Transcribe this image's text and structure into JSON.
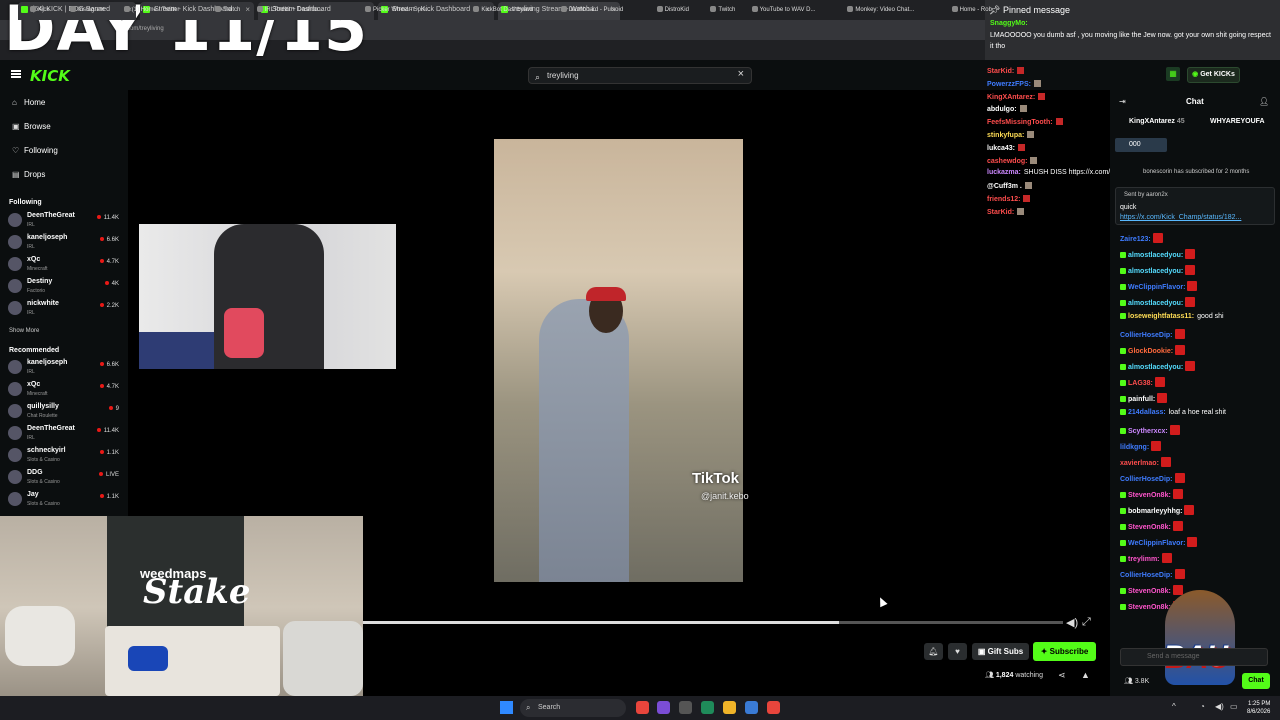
{
  "overlay": {
    "day_title": "DAY 11/15"
  },
  "browser": {
    "tabs": [
      {
        "label": "(64) KICK | DDG Banned"
      },
      {
        "label": "Stream - Kick Dashboard"
      },
      {
        "label": "Stream Dashboard"
      },
      {
        "label": "Stream - Kick Dashboard"
      },
      {
        "label": "treyliving Stream - Watch L"
      }
    ],
    "address": "kick.com/treyliving",
    "bookmarks": [
      "Kick",
      "Instagram",
      "(1) Home / Twitter",
      "Twitch",
      "IRLToolkit + Dashbo...",
      "Picker Wheel - Spin...",
      "KickBot Dashboard",
      "Dashboard - Pulsoid",
      "DistroKid",
      "Twitch",
      "YouTube to WAV D...",
      "Monkey: Video Chat...",
      "Home - Rob"
    ]
  },
  "kick": {
    "logo": "KICK",
    "search": {
      "value": "treyliving"
    },
    "nav": [
      {
        "label": "Home",
        "icon": "home-icon",
        "glyph": "⌂"
      },
      {
        "label": "Browse",
        "icon": "browse-icon",
        "glyph": "▣"
      },
      {
        "label": "Following",
        "icon": "heart-icon",
        "glyph": "♡"
      },
      {
        "label": "Drops",
        "icon": "drops-icon",
        "glyph": "▤"
      }
    ],
    "following_header": "Following",
    "following": [
      {
        "name": "DeenTheGreat",
        "category": "IRL",
        "viewers": "11.4K"
      },
      {
        "name": "kaneljoseph",
        "category": "IRL",
        "viewers": "6.6K"
      },
      {
        "name": "xQc",
        "category": "Minecraft",
        "viewers": "4.7K"
      },
      {
        "name": "Destiny",
        "category": "Factorio",
        "viewers": "4K"
      },
      {
        "name": "nickwhite",
        "category": "IRL",
        "viewers": "2.2K"
      }
    ],
    "show_more": "Show More",
    "recommended_header": "Recommended",
    "recommended": [
      {
        "name": "kaneljoseph",
        "category": "IRL",
        "viewers": "6.6K"
      },
      {
        "name": "xQc",
        "category": "Minecraft",
        "viewers": "4.7K"
      },
      {
        "name": "quillysilly",
        "category": "Chat Roulette",
        "viewers": "9"
      },
      {
        "name": "DeenTheGreat",
        "category": "IRL",
        "viewers": "11.4K"
      },
      {
        "name": "schneckyirl",
        "category": "Slots & Casino",
        "viewers": "1.1K"
      },
      {
        "name": "DDG",
        "category": "Slots & Casino",
        "viewers": "LIVE"
      },
      {
        "name": "Jay",
        "category": "Slots & Casino",
        "viewers": "1.1K"
      }
    ]
  },
  "player": {
    "tiktok_label": "TikTok",
    "tiktok_handle": "@janit.kebo",
    "webcam_sponsor1": "weedmaps",
    "webcam_sponsor2": "Stake",
    "progress": 0.68,
    "gift_subs": "Gift Subs",
    "subscribe": "Subscribe",
    "watching_count": "1,824",
    "watching_label": "watching"
  },
  "pinned": {
    "header": "Pinned message",
    "user": "SnaggyMo:",
    "message": "LMAOOOOO you dumb asf , you moving like the Jew now. got your own shit going respect it tho"
  },
  "overlay_chat": [
    {
      "user": "StarKid:",
      "color": "#ff4d4d",
      "text": ""
    },
    {
      "user": "PowerzzFPS:",
      "color": "#3f7cff",
      "text": ""
    },
    {
      "user": "KingXAntarez:",
      "color": "#ff4d4d",
      "text": ""
    },
    {
      "user": "abdulgo:",
      "color": "#ffffff",
      "text": ""
    },
    {
      "user": "FeefsMissingTooth:",
      "color": "#ff4d4d",
      "text": ""
    },
    {
      "user": "stinkyfupa:",
      "color": "#ffdd55",
      "text": ""
    },
    {
      "user": "lukca43:",
      "color": "#ffffff",
      "text": ""
    },
    {
      "user": "cashewdog:",
      "color": "#ff4d4d",
      "text": ""
    },
    {
      "user": "luckazma:",
      "color": "#cc88ff",
      "text": "SHUSH DISS https://x.com/lucka177/status/2085470509090308301"
    },
    {
      "user": "@Cuff3m .",
      "color": "#ffffff",
      "text": ""
    },
    {
      "user": "friends12:",
      "color": "#ff4d4d",
      "text": ""
    },
    {
      "user": "StarKid:",
      "color": "#ff4d4d",
      "text": ""
    }
  ],
  "chat": {
    "title": "Chat",
    "get_kicks": "Get KICKs",
    "top_pins": [
      "KingXAntarez",
      "WHYAREYOUFA"
    ],
    "top_pin_count": "45",
    "goal": "000",
    "sub_note": "bonescorin has subscribed for 2 months",
    "sent_by": "Sent by aaron2x",
    "sent_text": "quick",
    "sent_link": "https://x.com/Kick_Champ/status/182...",
    "messages": [
      {
        "user": "Zaire123:",
        "color": "#3f7cff",
        "text": "",
        "badge": false
      },
      {
        "user": "almostlacedyou:",
        "color": "#55ddff",
        "text": "",
        "badge": true
      },
      {
        "user": "almostlacedyou:",
        "color": "#55ddff",
        "text": "",
        "badge": true
      },
      {
        "user": "WeClippinFlavor:",
        "color": "#3f7cff",
        "text": "",
        "badge": true
      },
      {
        "user": "almostlacedyou:",
        "color": "#55ddff",
        "text": "",
        "badge": true
      },
      {
        "user": "loseweightfatass11:",
        "color": "#ffdd55",
        "text": "good shi",
        "badge": true
      },
      {
        "user": "CollierHoseDip:",
        "color": "#3f7cff",
        "text": "",
        "badge": false
      },
      {
        "user": "GlockDookie:",
        "color": "#ff6a3d",
        "text": "",
        "badge": true
      },
      {
        "user": "almostlacedyou:",
        "color": "#55ddff",
        "text": "",
        "badge": true
      },
      {
        "user": "LAG38:",
        "color": "#ff4d4d",
        "text": "",
        "badge": true
      },
      {
        "user": "painfull:",
        "color": "#ffffff",
        "text": "",
        "badge": true
      },
      {
        "user": "214dallass:",
        "color": "#3f7cff",
        "text": "loaf a hoe real shit",
        "badge": true
      },
      {
        "user": "Scytherxcx:",
        "color": "#cc88ff",
        "text": "",
        "badge": true
      },
      {
        "user": "lildkgng:",
        "color": "#3f7cff",
        "text": "",
        "badge": false
      },
      {
        "user": "xavierlmao:",
        "color": "#ff4d4d",
        "text": "",
        "badge": false
      },
      {
        "user": "CollierHoseDip:",
        "color": "#3f7cff",
        "text": "",
        "badge": false
      },
      {
        "user": "StevenOn8k:",
        "color": "#ff55cc",
        "text": "",
        "badge": true
      },
      {
        "user": "bobmarleyyhhg:",
        "color": "#ffffff",
        "text": "",
        "badge": true
      },
      {
        "user": "StevenOn8k:",
        "color": "#ff55cc",
        "text": "",
        "badge": true
      },
      {
        "user": "WeClippinFlavor:",
        "color": "#3f7cff",
        "text": "",
        "badge": true
      },
      {
        "user": "treylimm:",
        "color": "#ff55cc",
        "text": "",
        "badge": true
      },
      {
        "user": "CollierHoseDip:",
        "color": "#3f7cff",
        "text": "",
        "badge": false
      },
      {
        "user": "StevenOn8k:",
        "color": "#ff55cc",
        "text": "",
        "badge": true
      },
      {
        "user": "StevenOn8k:",
        "color": "#ff55cc",
        "text": "",
        "badge": true
      }
    ],
    "input_placeholder": "Send a message",
    "viewer_count": "3.8K",
    "chat_button": "Chat",
    "mascot_text": "BAU"
  },
  "taskbar": {
    "search_placeholder": "Search",
    "time": "1:25 PM",
    "date": "8/6/2026"
  }
}
